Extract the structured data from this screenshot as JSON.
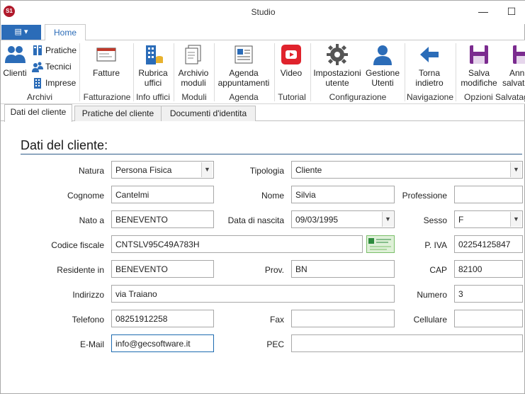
{
  "window": {
    "title": "Studio",
    "app_icon_text": "S1"
  },
  "ribbon_tabs": {
    "file_label": "▤ ▾",
    "home_label": "Home"
  },
  "ribbon": {
    "clienti": "Clienti",
    "pratiche": "Pratiche",
    "tecnici": "Tecnici",
    "imprese": "Imprese",
    "fatture": "Fatture",
    "rubrica_1": "Rubrica",
    "rubrica_2": "uffici",
    "archivio_1": "Archivio",
    "archivio_2": "moduli",
    "agenda_1": "Agenda",
    "agenda_2": "appuntamenti",
    "video": "Video",
    "impostazioni_1": "Impostazioni",
    "impostazioni_2": "utente",
    "gestione_1": "Gestione",
    "gestione_2": "Utenti",
    "torna_1": "Torna",
    "torna_2": "indietro",
    "salva_1": "Salva",
    "salva_2": "modifiche",
    "annulla_1": "Anni",
    "annulla_2": "salvata",
    "groups": {
      "archivi": "Archivi",
      "fatturazione": "Fatturazione",
      "info_uffici": "Info uffici",
      "moduli": "Moduli",
      "agenda": "Agenda",
      "tutorial": "Tutorial",
      "configurazione": "Configurazione",
      "navigazione": "Navigazione",
      "opzioni": "Opzioni Salvatag"
    }
  },
  "doc_tabs": [
    "Dati del cliente",
    "Pratiche del cliente",
    "Documenti d'identita"
  ],
  "section_title": "Dati del cliente:",
  "form": {
    "natura_label": "Natura",
    "natura_value": "Persona Fisica",
    "tipologia_label": "Tipologia",
    "tipologia_value": "Cliente",
    "cognome_label": "Cognome",
    "cognome_value": "Cantelmi",
    "nome_label": "Nome",
    "nome_value": "Silvia",
    "professione_label": "Professione",
    "professione_value": "",
    "nato_label": "Nato a",
    "nato_value": "BENEVENTO",
    "data_label": "Data di nascita",
    "data_value": "09/03/1995",
    "sesso_label": "Sesso",
    "sesso_value": "F",
    "cf_label": "Codice fiscale",
    "cf_value": "CNTSLV95C49A783H",
    "piva_label": "P. IVA",
    "piva_value": "02254125847",
    "residente_label": "Residente in",
    "residente_value": "BENEVENTO",
    "prov_label": "Prov.",
    "prov_value": "BN",
    "cap_label": "CAP",
    "cap_value": "82100",
    "indirizzo_label": "Indirizzo",
    "indirizzo_value": "via Traiano",
    "numero_label": "Numero",
    "numero_value": "3",
    "telefono_label": "Telefono",
    "telefono_value": "08251912258",
    "fax_label": "Fax",
    "fax_value": "",
    "cellulare_label": "Cellulare",
    "cellulare_value": "",
    "email_label": "E-Mail",
    "email_value": "info@gecsoftware.it",
    "pec_label": "PEC",
    "pec_value": ""
  },
  "colors": {
    "accent": "#2b6cb8",
    "title_line": "#2e5c8a",
    "app_icon": "#b0192b",
    "video_red": "#e0232d",
    "save_purple": "#7b2b8f"
  }
}
